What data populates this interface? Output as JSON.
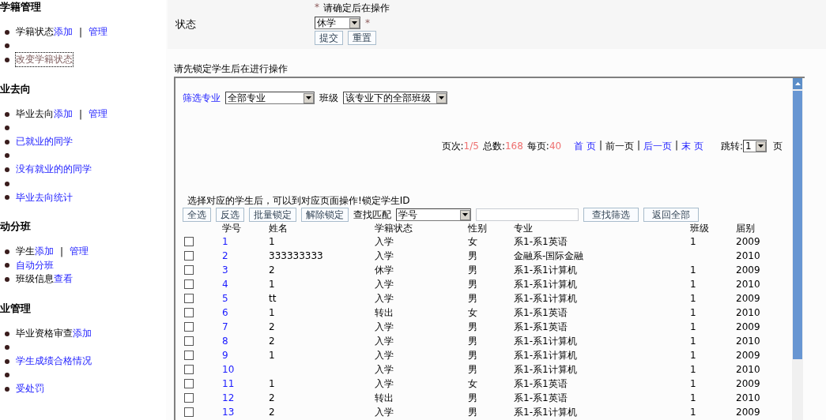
{
  "sidebar": [
    {
      "title": "学籍管理",
      "items": [
        {
          "kind": "entry",
          "focused": false,
          "parts": [
            {
              "kind": "text",
              "text": "学籍状态"
            },
            {
              "kind": "link",
              "text": "添加"
            },
            {
              "kind": "sep",
              "text": "|"
            },
            {
              "kind": "link",
              "text": "管理"
            }
          ]
        },
        {
          "kind": "blank"
        },
        {
          "kind": "entry",
          "focused": true,
          "parts": [
            {
              "kind": "visited",
              "text": "改变学籍状态"
            }
          ]
        }
      ]
    },
    {
      "title": "业去向",
      "items": [
        {
          "kind": "entry",
          "focused": false,
          "parts": [
            {
              "kind": "text",
              "text": "毕业去向"
            },
            {
              "kind": "link",
              "text": "添加"
            },
            {
              "kind": "sep",
              "text": "|"
            },
            {
              "kind": "link",
              "text": "管理"
            }
          ]
        },
        {
          "kind": "blank"
        },
        {
          "kind": "entry",
          "focused": false,
          "parts": [
            {
              "kind": "link",
              "text": "已就业的同学"
            }
          ]
        },
        {
          "kind": "blank"
        },
        {
          "kind": "entry",
          "focused": false,
          "parts": [
            {
              "kind": "link",
              "text": "没有就业的的同学"
            }
          ]
        },
        {
          "kind": "blank"
        },
        {
          "kind": "entry",
          "focused": false,
          "parts": [
            {
              "kind": "link",
              "text": "毕业去向统计"
            }
          ]
        }
      ]
    },
    {
      "title": "动分班",
      "items": [
        {
          "kind": "entry",
          "focused": false,
          "parts": [
            {
              "kind": "text",
              "text": "学生"
            },
            {
              "kind": "link",
              "text": "添加"
            },
            {
              "kind": "sep",
              "text": "|"
            },
            {
              "kind": "link",
              "text": "管理"
            }
          ]
        },
        {
          "kind": "entry",
          "focused": false,
          "parts": [
            {
              "kind": "link",
              "text": "自动分班"
            }
          ]
        },
        {
          "kind": "entry",
          "focused": false,
          "parts": [
            {
              "kind": "text",
              "text": "班级信息"
            },
            {
              "kind": "link",
              "text": "查看"
            }
          ]
        }
      ]
    },
    {
      "title": "业管理",
      "items": [
        {
          "kind": "entry",
          "focused": false,
          "parts": [
            {
              "kind": "text",
              "text": "毕业资格审查"
            },
            {
              "kind": "link",
              "text": "添加"
            }
          ]
        },
        {
          "kind": "blank"
        },
        {
          "kind": "entry",
          "focused": false,
          "parts": [
            {
              "kind": "link",
              "text": "学生成绩合格情况"
            }
          ]
        },
        {
          "kind": "blank"
        },
        {
          "kind": "entry",
          "focused": false,
          "parts": [
            {
              "kind": "link",
              "text": "受处罚"
            }
          ]
        }
      ]
    }
  ],
  "form": {
    "label": "状态",
    "mark": "*",
    "hint": "请确定后在操作",
    "status_value": "休学",
    "required_mark": "*",
    "buttons": [
      "提交",
      "重置"
    ]
  },
  "notice": "请先锁定学生后在进行操作",
  "filter": {
    "major_link": "筛选专业",
    "major_value": "全部专业",
    "class_label": "班级",
    "class_value": "该专业下的全部班级"
  },
  "pager": {
    "page_label": "页次:",
    "page": "1/5",
    "total_label": "总数:",
    "total": "168",
    "per_label": "每页:",
    "per": "40",
    "nav": [
      {
        "kind": "link",
        "text": "首 页"
      },
      {
        "kind": "sep",
        "text": "|"
      },
      {
        "kind": "text",
        "text": "前一页"
      },
      {
        "kind": "sep",
        "text": "|"
      },
      {
        "kind": "link",
        "text": "后一页"
      },
      {
        "kind": "sep",
        "text": "|"
      },
      {
        "kind": "link",
        "text": "末 页"
      }
    ],
    "jump_label": "跳转:",
    "jump_value": "1",
    "unit": "页"
  },
  "instruction": "选择对应的学生后，可以到对应页面操作!锁定学生ID",
  "toolbar": {
    "left_buttons": [
      "全选",
      "反选",
      "批量锁定",
      "解除锁定"
    ],
    "match_label": "查找匹配",
    "match_value": "学号",
    "right_buttons": [
      "查找筛选",
      "返回全部"
    ]
  },
  "table": {
    "columns": [
      "学号",
      "姓名",
      "学籍状态",
      "性别",
      "专业",
      "班级",
      "届别"
    ],
    "rows": [
      {
        "checked": false,
        "id": "1",
        "name": "1",
        "status": "入学",
        "sex": "女",
        "major": "系1-系1英语",
        "class": "1",
        "year": "2009"
      },
      {
        "checked": false,
        "id": "2",
        "name": "333333333",
        "status": "入学",
        "sex": "男",
        "major": "金融系-国际金融",
        "year": "2010"
      },
      {
        "checked": false,
        "id": "3",
        "name": "2",
        "status": "休学",
        "sex": "男",
        "major": "系1-系1计算机",
        "class": "1",
        "year": "2009"
      },
      {
        "checked": false,
        "id": "4",
        "name": "1",
        "status": "入学",
        "sex": "男",
        "major": "系1-系1计算机",
        "class": "1",
        "year": "2010"
      },
      {
        "checked": false,
        "id": "5",
        "name": "tt",
        "status": "入学",
        "sex": "男",
        "major": "系1-系1计算机",
        "class": "1",
        "year": "2009"
      },
      {
        "checked": false,
        "id": "6",
        "name": "1",
        "status": "转出",
        "sex": "女",
        "major": "系1-系1英语",
        "class": "1",
        "year": "2010"
      },
      {
        "checked": false,
        "id": "7",
        "name": "2",
        "status": "入学",
        "sex": "男",
        "major": "系1-系1英语",
        "class": "1",
        "year": "2009"
      },
      {
        "checked": false,
        "id": "8",
        "name": "2",
        "status": "入学",
        "sex": "男",
        "major": "系1-系1计算机",
        "class": "1",
        "year": "2010"
      },
      {
        "checked": false,
        "id": "9",
        "name": "1",
        "status": "入学",
        "sex": "男",
        "major": "系1-系1计算机",
        "class": "1",
        "year": "2009"
      },
      {
        "checked": false,
        "id": "10",
        "status": "入学",
        "sex": "男",
        "major": "系1-系1计算机",
        "class": "1",
        "year": "2010"
      },
      {
        "checked": false,
        "id": "11",
        "name": "1",
        "status": "入学",
        "sex": "女",
        "major": "系1-系1英语",
        "class": "1",
        "year": "2009"
      },
      {
        "checked": false,
        "id": "12",
        "name": "2",
        "status": "转出",
        "sex": "男",
        "major": "系1-系1英语",
        "class": "1",
        "year": "2010"
      },
      {
        "checked": false,
        "id": "13",
        "name": "2",
        "status": "入学",
        "sex": "男",
        "major": "系1-系1计算机",
        "class": "1",
        "year": "2009"
      }
    ]
  }
}
